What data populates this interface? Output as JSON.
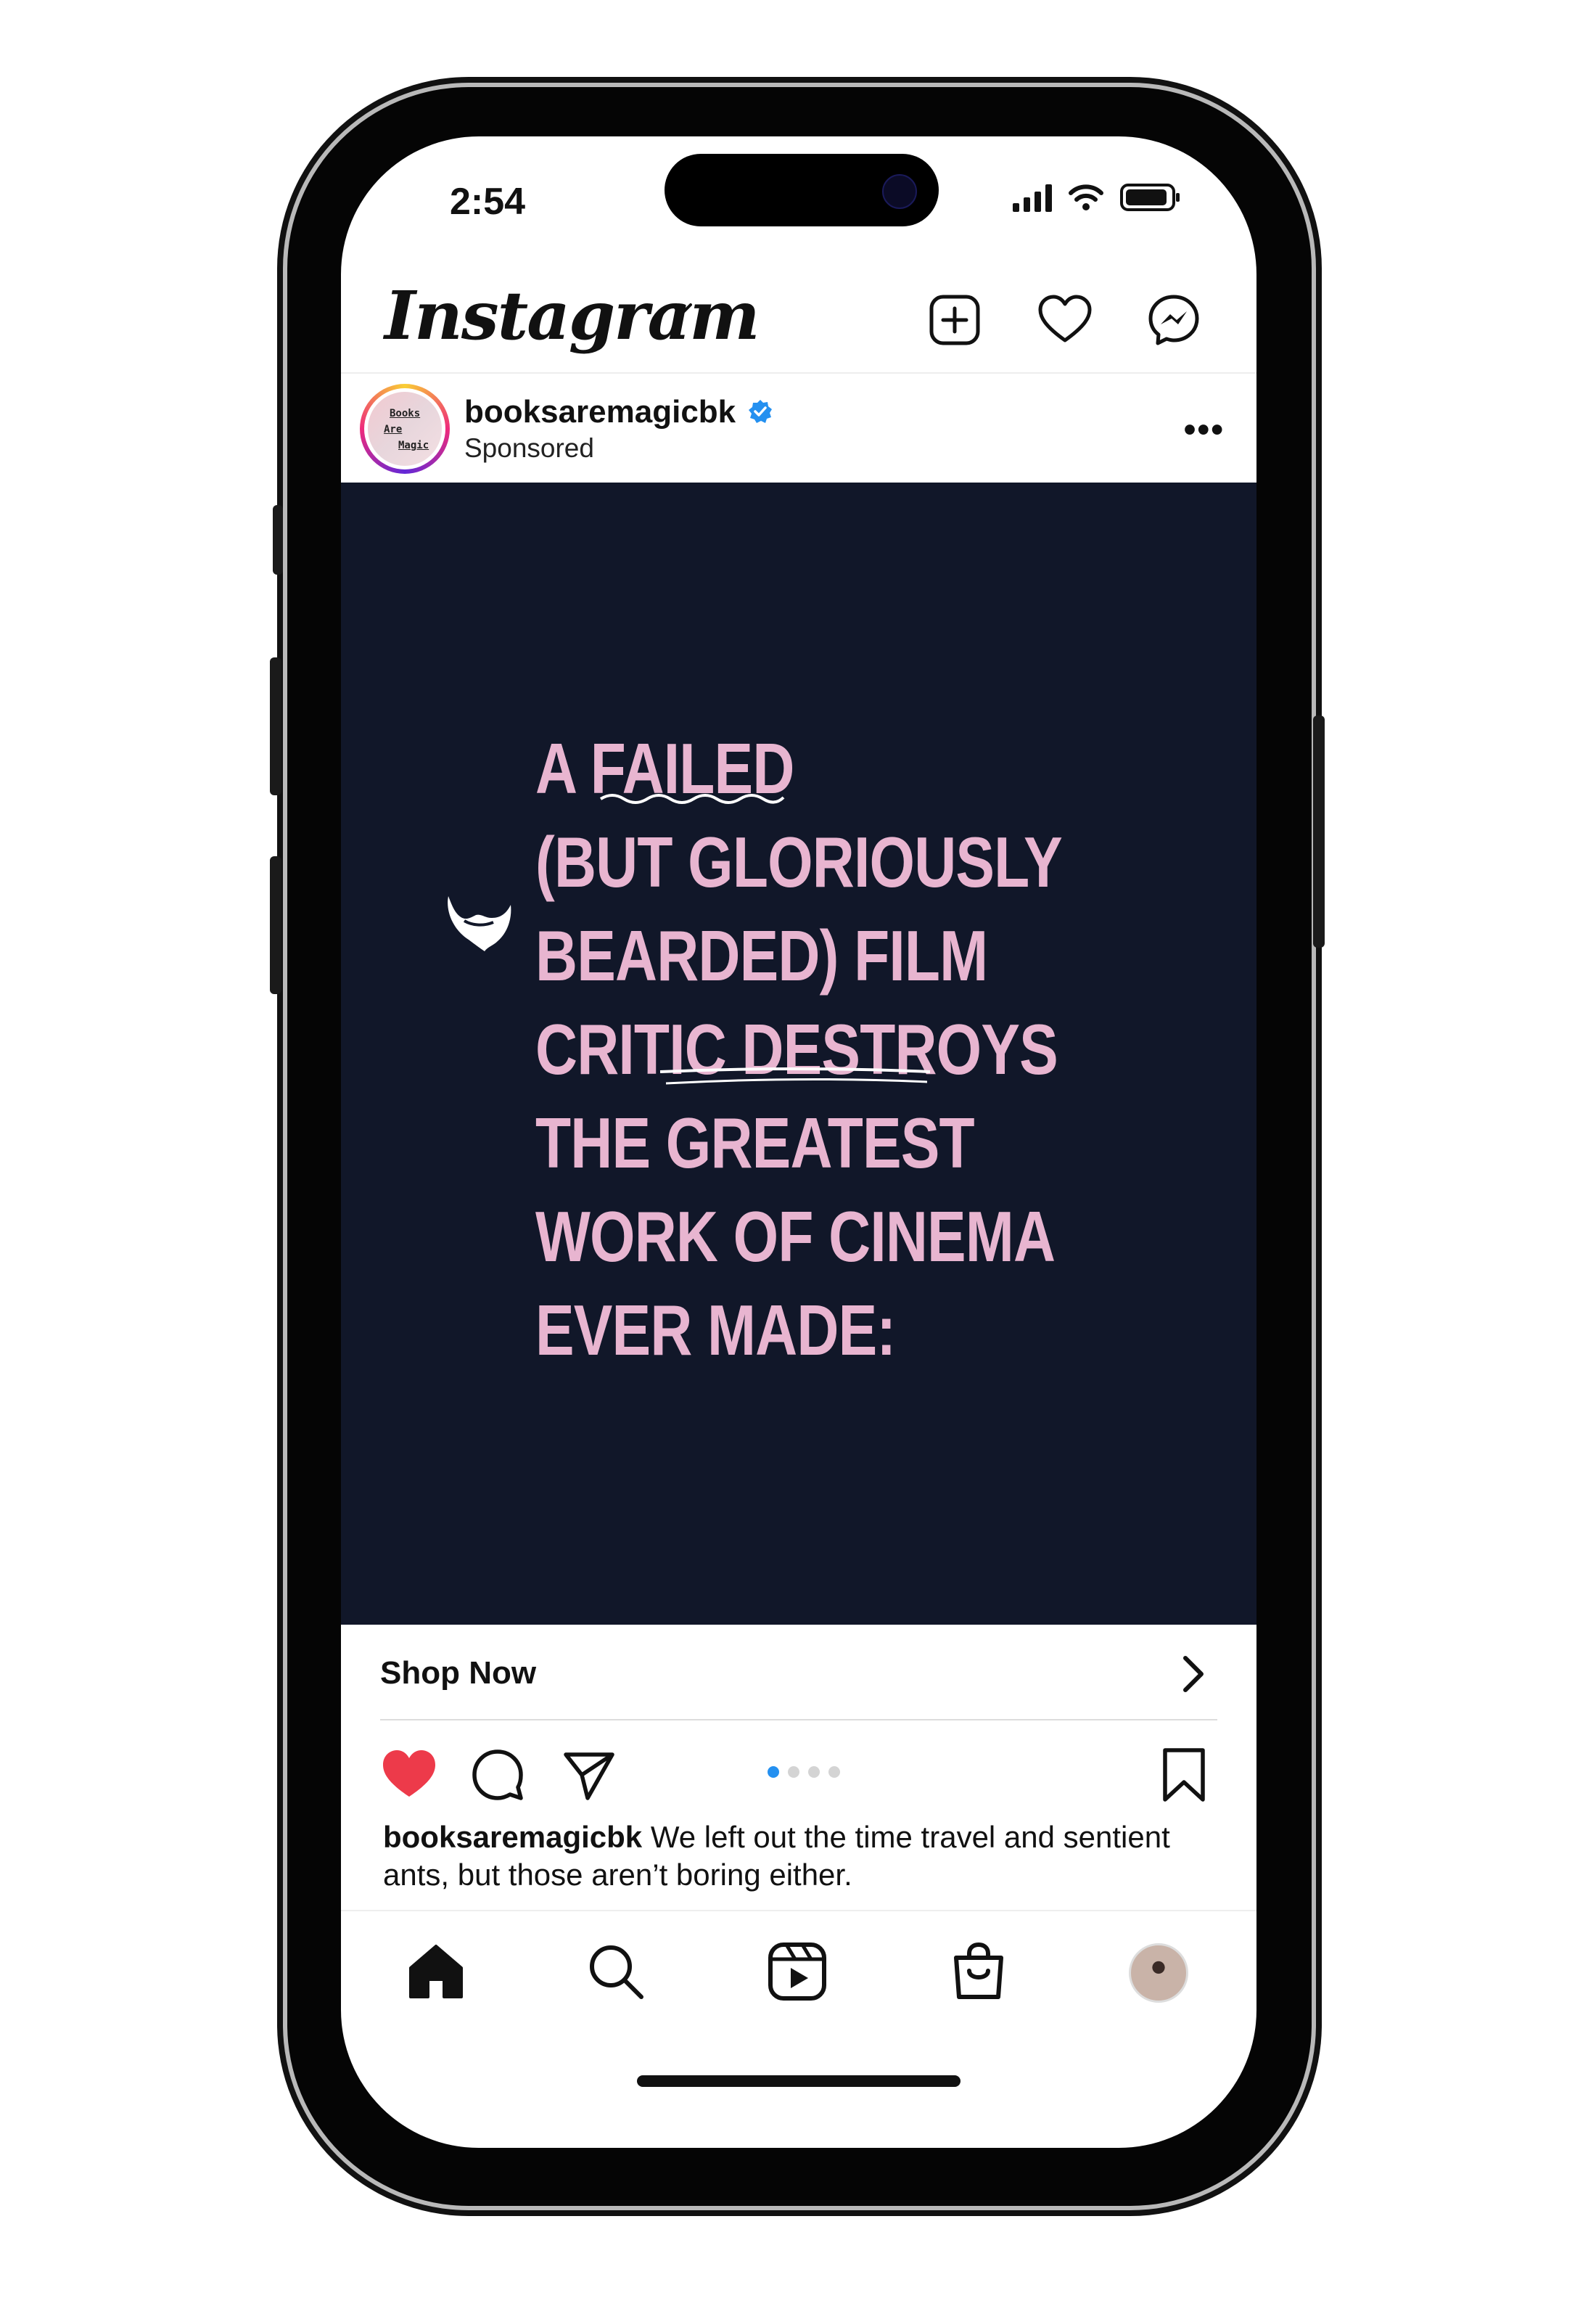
{
  "status": {
    "time": "2:54"
  },
  "app": {
    "name": "Instagram"
  },
  "post": {
    "username": "booksaremagicbk",
    "subtitle": "Sponsored",
    "avatar_text": [
      "Books",
      "Are",
      "Magic"
    ],
    "headline_lines": [
      "A FAILED",
      "(BUT GLORIOUSLY",
      "BEARDED) FILM",
      "CRITIC DESTROYS",
      "THE GREATEST",
      "WORK OF CINEMA",
      "EVER MADE:"
    ],
    "cta_label": "Shop Now",
    "carousel": {
      "count": 4,
      "active": 1
    },
    "caption_user": "booksaremagicbk",
    "caption_text": "We left out the time travel and sentient ants, but those aren’t boring either.",
    "liked": true
  },
  "colors": {
    "image_bg": "#111729",
    "headline": "#e8b5d0",
    "like_red": "#ed3a4a",
    "verified_blue": "#2490f0"
  },
  "icons": {
    "header": [
      "new-post-icon",
      "heart-icon",
      "messenger-icon"
    ],
    "actions": [
      "heart-filled-icon",
      "comment-icon",
      "share-icon",
      "bookmark-icon"
    ],
    "tabs": [
      "home-icon",
      "search-icon",
      "reels-icon",
      "shop-icon",
      "profile-avatar"
    ]
  }
}
